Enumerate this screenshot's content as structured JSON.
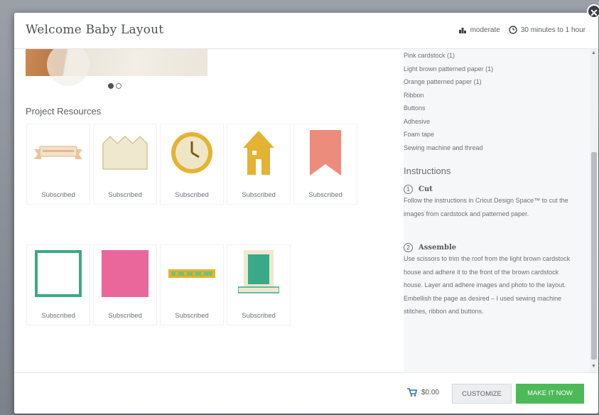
{
  "header": {
    "title": "Welcome Baby Layout",
    "difficulty": "moderate",
    "time": "30 minutes to 1 hour"
  },
  "carousel": {
    "slides": 2,
    "active": 1
  },
  "resources": {
    "title": "Project Resources",
    "tiles": [
      {
        "label": "Subscribed",
        "icon": "ribbon-banner-icon"
      },
      {
        "label": "Subscribed",
        "icon": "crown-border-icon"
      },
      {
        "label": "Subscribed",
        "icon": "clock-icon"
      },
      {
        "label": "Subscribed",
        "icon": "house-icon"
      },
      {
        "label": "Subscribed",
        "icon": "pennant-flag-icon"
      },
      {
        "label": "Subscribed",
        "icon": "square-frame-icon"
      },
      {
        "label": "Subscribed",
        "icon": "pink-square-icon"
      },
      {
        "label": "Subscribed",
        "icon": "welcome-word-icon"
      },
      {
        "label": "Subscribed",
        "icon": "photo-frame-icon"
      }
    ]
  },
  "materials": [
    "Pink cardstock (1)",
    "Light brown patterned paper (1)",
    "Orange patterned paper (1)",
    "Ribbon",
    "Buttons",
    "Adhesive",
    "Foam tape",
    "Sewing machine and thread"
  ],
  "instructions": {
    "title": "Instructions",
    "steps": [
      {
        "num": "1",
        "title": "Cut",
        "body": "Follow the instructions in Cricut Design Space™ to cut the images from cardstock and patterned paper."
      },
      {
        "num": "2",
        "title": "Assemble",
        "body": "Use scissors to trim the roof from the light brown cardstock house and adhere it to the front of the brown cardstock house. Layer and adhere images and photo to the layout. Embellish the page as desired – I used sewing machine stitches, ribbon and buttons."
      }
    ]
  },
  "footer": {
    "price": "$0.00",
    "customize": "CUSTOMIZE",
    "make": "MAKE IT NOW"
  },
  "colors": {
    "accent_green": "#4cba57",
    "tile_gold": "#e3b331",
    "tile_cream": "#efe8cf",
    "tile_coral": "#ec8c7c",
    "tile_pink": "#e9679a",
    "tile_teal": "#3aa987"
  }
}
